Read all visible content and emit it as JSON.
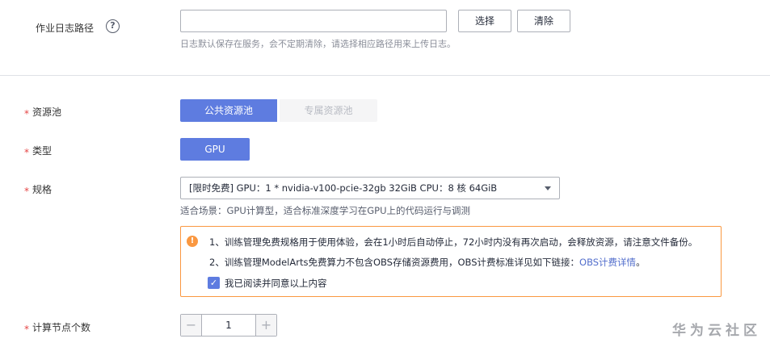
{
  "log_path": {
    "label": "作业日志路径",
    "help_glyph": "?",
    "value": "",
    "select_label": "选择",
    "clear_label": "清除",
    "hint": "日志默认保存在服务，会不定期清除，请选择相应路径用来上传日志。"
  },
  "required_mark": "*",
  "resource_pool": {
    "label": "资源池",
    "options": [
      "公共资源池",
      "专属资源池"
    ],
    "selected": "公共资源池"
  },
  "type": {
    "label": "类型",
    "value": "GPU"
  },
  "spec": {
    "label": "规格",
    "selected": "[限时免费] GPU：1 * nvidia-v100-pcie-32gb 32GiB CPU：8 核 64GiB",
    "scene": "适合场景：GPU计算型，适合标准深度学习在GPU上的代码运行与调测"
  },
  "notice": {
    "icon_glyph": "!",
    "line1": "1、训练管理免费规格用于使用体验，会在1小时后自动停止，72小时内没有再次启动，会释放资源，请注意文件备份。",
    "line2_prefix": "2、训练管理ModelArts免费算力不包含OBS存储资源费用，OBS计费标准详见如下链接：",
    "line2_link": "OBS计费详情",
    "line2_suffix": "。",
    "agree_text": "我已阅读并同意以上内容",
    "agree_checked": true,
    "check_glyph": "✓"
  },
  "node_count": {
    "label": "计算节点个数",
    "value": "1",
    "minus_glyph": "−",
    "plus_glyph": "+"
  },
  "watermark": "华为云社区",
  "colors": {
    "primary": "#5e7ce0",
    "warning": "#fa9841",
    "required": "#e54545",
    "link": "#526ecc"
  }
}
